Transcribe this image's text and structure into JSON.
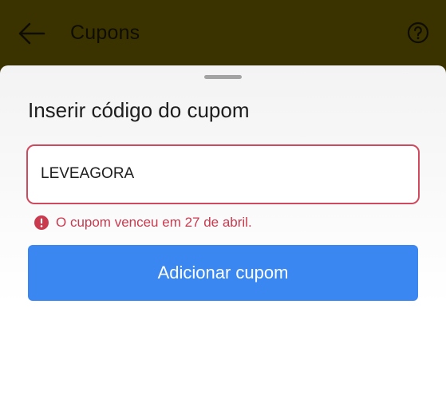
{
  "app_bar": {
    "title": "Cupons",
    "back_icon": "arrow-left-icon",
    "help_icon": "help-circle-icon"
  },
  "sheet": {
    "title": "Inserir código do cupom",
    "coupon_input": {
      "value": "LEVEAGORA",
      "state": "error"
    },
    "error_message": "O cupom venceu em 27 de abril.",
    "error_icon": "alert-circle-icon",
    "submit_label": "Adicionar cupom"
  },
  "colors": {
    "app_bar_overlay": "#3a3300",
    "error": "#c93a4f",
    "input_border_error": "#cf4a5e",
    "primary": "#3a87f2"
  }
}
